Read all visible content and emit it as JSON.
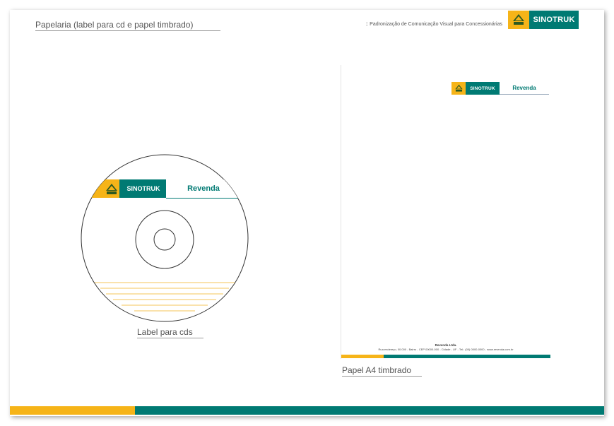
{
  "header": {
    "section_title": "Papelaria (label para cd e papel timbrado)",
    "subtitle": ":: Padronização de Comunicação Visual para Concessionárias",
    "brand": "SINOTRUK"
  },
  "cd_label": {
    "brand": "SINOTRUK",
    "dealer": "Revenda",
    "caption": "Label para cds"
  },
  "letterhead": {
    "brand": "SINOTRUK",
    "dealer": "Revenda",
    "company": "Revenda Ltda.",
    "address": "Rua endereço, 00.000 - Bairro - CEP 00000-000 - Cidade - UF - Tel.: (00) 0000-0000 - www.revenda.com.br",
    "caption": "Papel A4 timbrado"
  },
  "colors": {
    "brand_yellow": "#f6b418",
    "brand_teal": "#007a73",
    "line_yellow": "#f6c65a"
  }
}
